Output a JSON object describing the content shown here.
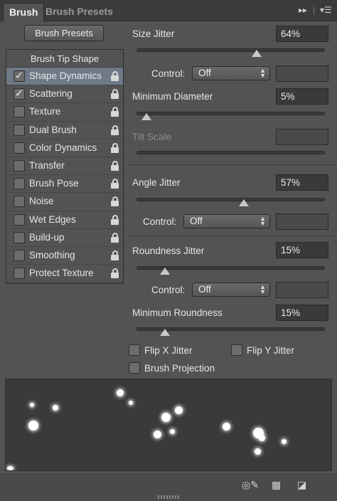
{
  "tabs": [
    {
      "label": "Brush"
    },
    {
      "label": "Brush Presets"
    }
  ],
  "tab_controls": {
    "collapse_icon": "double-chevron-right-icon",
    "menu_icon": "panel-menu-icon"
  },
  "presets_button": "Brush Presets",
  "sidebar": {
    "header": "Brush Tip Shape",
    "items": [
      {
        "label": "Shape Dynamics",
        "checked": true,
        "selected": true
      },
      {
        "label": "Scattering",
        "checked": true
      },
      {
        "label": "Texture",
        "checked": false
      },
      {
        "label": "Dual Brush",
        "checked": false
      },
      {
        "label": "Color Dynamics",
        "checked": false
      },
      {
        "label": "Transfer",
        "checked": false
      },
      {
        "label": "Brush Pose",
        "checked": false
      },
      {
        "label": "Noise",
        "checked": false
      },
      {
        "label": "Wet Edges",
        "checked": false
      },
      {
        "label": "Build-up",
        "checked": false
      },
      {
        "label": "Smoothing",
        "checked": false
      },
      {
        "label": "Protect Texture",
        "checked": false
      }
    ]
  },
  "settings": {
    "size_jitter": {
      "label": "Size Jitter",
      "value": "64%",
      "level": 0.64
    },
    "size_control": {
      "label": "Control:",
      "value": "Off"
    },
    "min_diameter": {
      "label": "Minimum Diameter",
      "value": "5%",
      "level": 0.05
    },
    "tilt_scale": {
      "label": "Tilt Scale",
      "value": ""
    },
    "angle_jitter": {
      "label": "Angle Jitter",
      "value": "57%",
      "level": 0.57
    },
    "angle_control": {
      "label": "Control:",
      "value": "Off"
    },
    "roundness_jitter": {
      "label": "Roundness Jitter",
      "value": "15%",
      "level": 0.15
    },
    "roundness_control": {
      "label": "Control:",
      "value": "Off"
    },
    "min_roundness": {
      "label": "Minimum Roundness",
      "value": "15%",
      "level": 0.15
    },
    "flip_x": {
      "label": "Flip X Jitter",
      "checked": false
    },
    "flip_y": {
      "label": "Flip Y Jitter",
      "checked": false
    },
    "projection": {
      "label": "Brush Projection",
      "checked": false
    }
  },
  "footer": {
    "icons": [
      "eye-brush-icon",
      "grid-icon",
      "new-preset-icon"
    ]
  },
  "colors": {
    "panel": "#535353",
    "selected_row": "#6e7a88",
    "field": "#3a3a3a"
  }
}
